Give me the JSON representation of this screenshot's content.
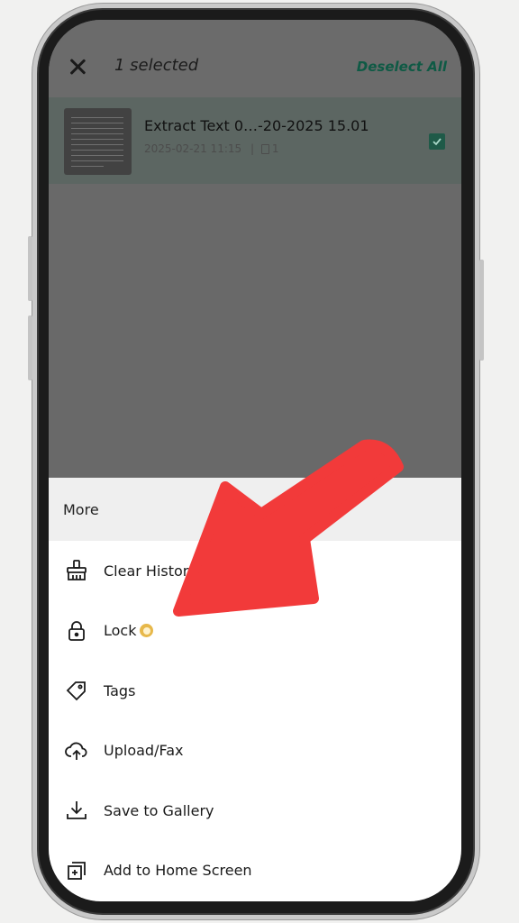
{
  "header": {
    "selection_count": "1 selected",
    "deselect_label": "Deselect All"
  },
  "document": {
    "title": "Extract Text 0…-20-2025 15.01",
    "date": "2025-02-21 11:15",
    "separator": "|",
    "page_count": "1",
    "selected": true
  },
  "sheet": {
    "title": "More",
    "items": [
      {
        "label": "Clear History",
        "icon": "broom-icon"
      },
      {
        "label": "Lock",
        "icon": "lock-icon",
        "premium": true
      },
      {
        "label": "Tags",
        "icon": "tag-icon"
      },
      {
        "label": "Upload/Fax",
        "icon": "cloud-upload-icon"
      },
      {
        "label": "Save to Gallery",
        "icon": "download-icon"
      },
      {
        "label": "Add to Home Screen",
        "icon": "add-to-home-icon"
      }
    ]
  },
  "colors": {
    "accent": "#0f5a45",
    "overlay": "#696969",
    "annotation_arrow": "#f23a3a",
    "premium_badge": "#e7b84a"
  }
}
